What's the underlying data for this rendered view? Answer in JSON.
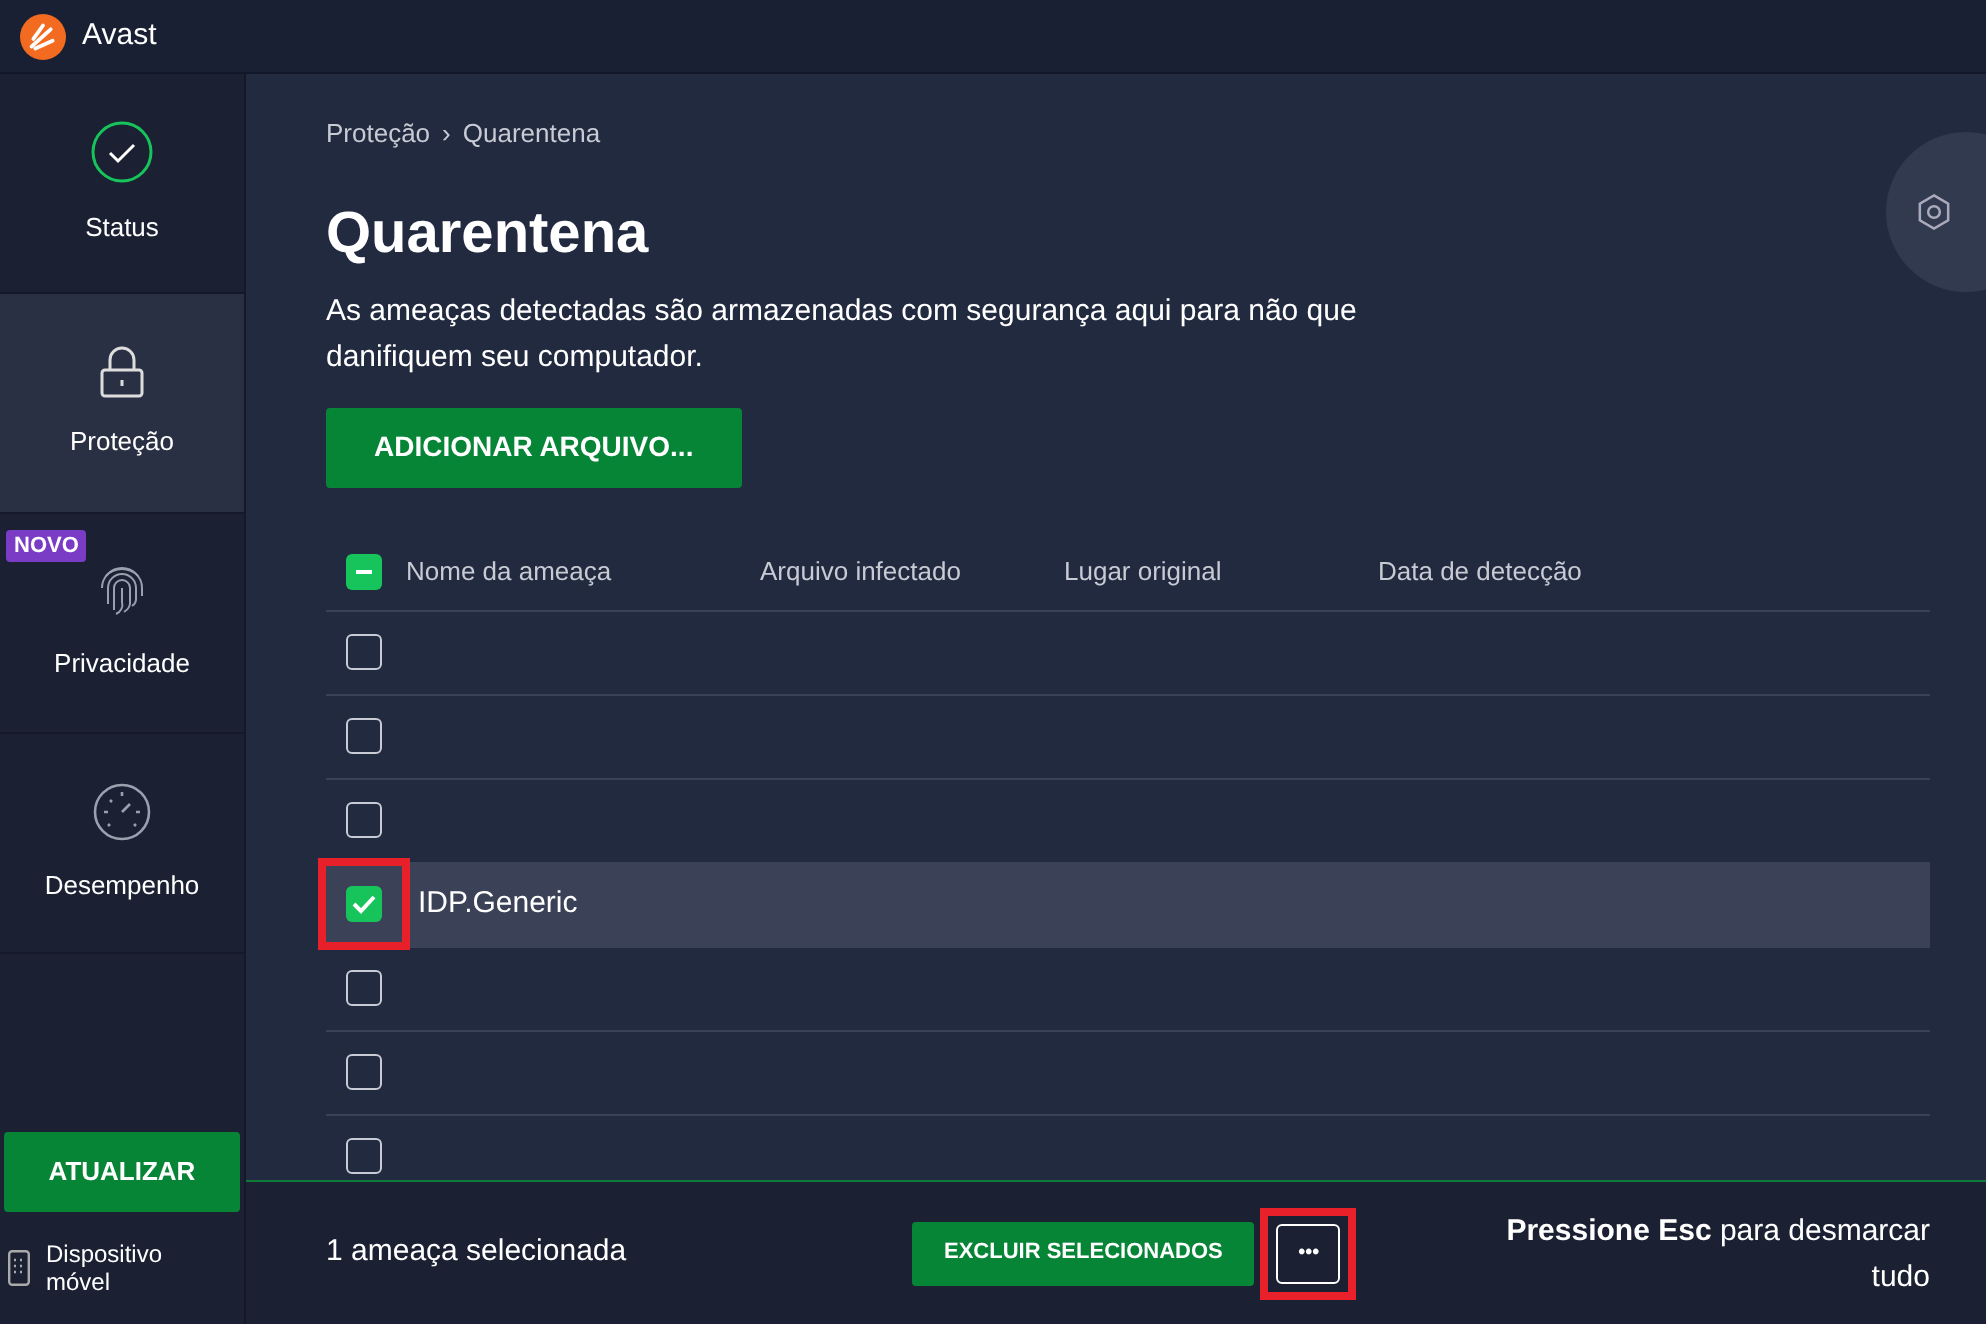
{
  "app": {
    "title": "Avast"
  },
  "sidebar": {
    "items": [
      {
        "label": "Status",
        "kind": "status",
        "selected": false
      },
      {
        "label": "Proteção",
        "kind": "protection",
        "selected": true
      },
      {
        "label": "Privacidade",
        "kind": "privacy",
        "selected": false,
        "badge": "NOVO"
      },
      {
        "label": "Desempenho",
        "kind": "performance",
        "selected": false
      }
    ],
    "update_button": "ATUALIZAR",
    "mobile_link": "Dispositivo móvel"
  },
  "breadcrumb": [
    "Proteção",
    "›",
    "Quarentena"
  ],
  "page": {
    "title": "Quarentena",
    "description": "As ameaças detectadas são armazenadas com segurança aqui para não que danifiquem seu computador.",
    "add_button": "ADICIONAR ARQUIVO..."
  },
  "table": {
    "select_all": {
      "indeterminate": true
    },
    "columns": [
      "Nome da ameaça",
      "Arquivo infectado",
      "Lugar original",
      "Data de detecção"
    ],
    "rows": [
      {
        "name": "",
        "checked": false,
        "selected": false
      },
      {
        "name": "",
        "checked": false,
        "selected": false
      },
      {
        "name": "",
        "checked": false,
        "selected": false
      },
      {
        "name": "IDP.Generic",
        "checked": true,
        "selected": true
      },
      {
        "name": "",
        "checked": false,
        "selected": false
      },
      {
        "name": "",
        "checked": false,
        "selected": false
      },
      {
        "name": "",
        "checked": false,
        "selected": false
      }
    ]
  },
  "footer": {
    "selection_count": "1 ameaça selecionada",
    "delete_button": "EXCLUIR SELECIONADOS",
    "more_button": "•••",
    "hint": "**Pressione Esc** para desmarcar tudo"
  }
}
